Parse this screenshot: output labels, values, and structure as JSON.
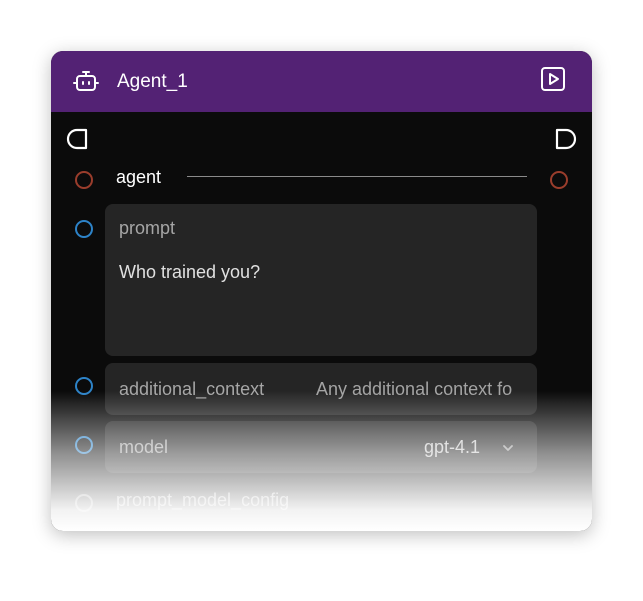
{
  "node": {
    "title": "Agent_1",
    "header_color": "#532274",
    "icons": {
      "type_icon": "robot-icon",
      "run_icon": "play-square-icon"
    }
  },
  "ports": {
    "agent": {
      "label": "agent"
    },
    "prompt": {
      "label": "prompt",
      "value": "Who trained you?"
    },
    "additional_context": {
      "label": "additional_context",
      "placeholder": "Any additional context fo"
    },
    "model": {
      "label": "model",
      "value": "gpt-4.1"
    },
    "prompt_model_config": {
      "label": "prompt_model_config"
    }
  },
  "colors": {
    "output_port": "#9a3d2c",
    "input_port": "#2d83c8",
    "canvas": "#0b0b0b",
    "field": "#252525"
  }
}
